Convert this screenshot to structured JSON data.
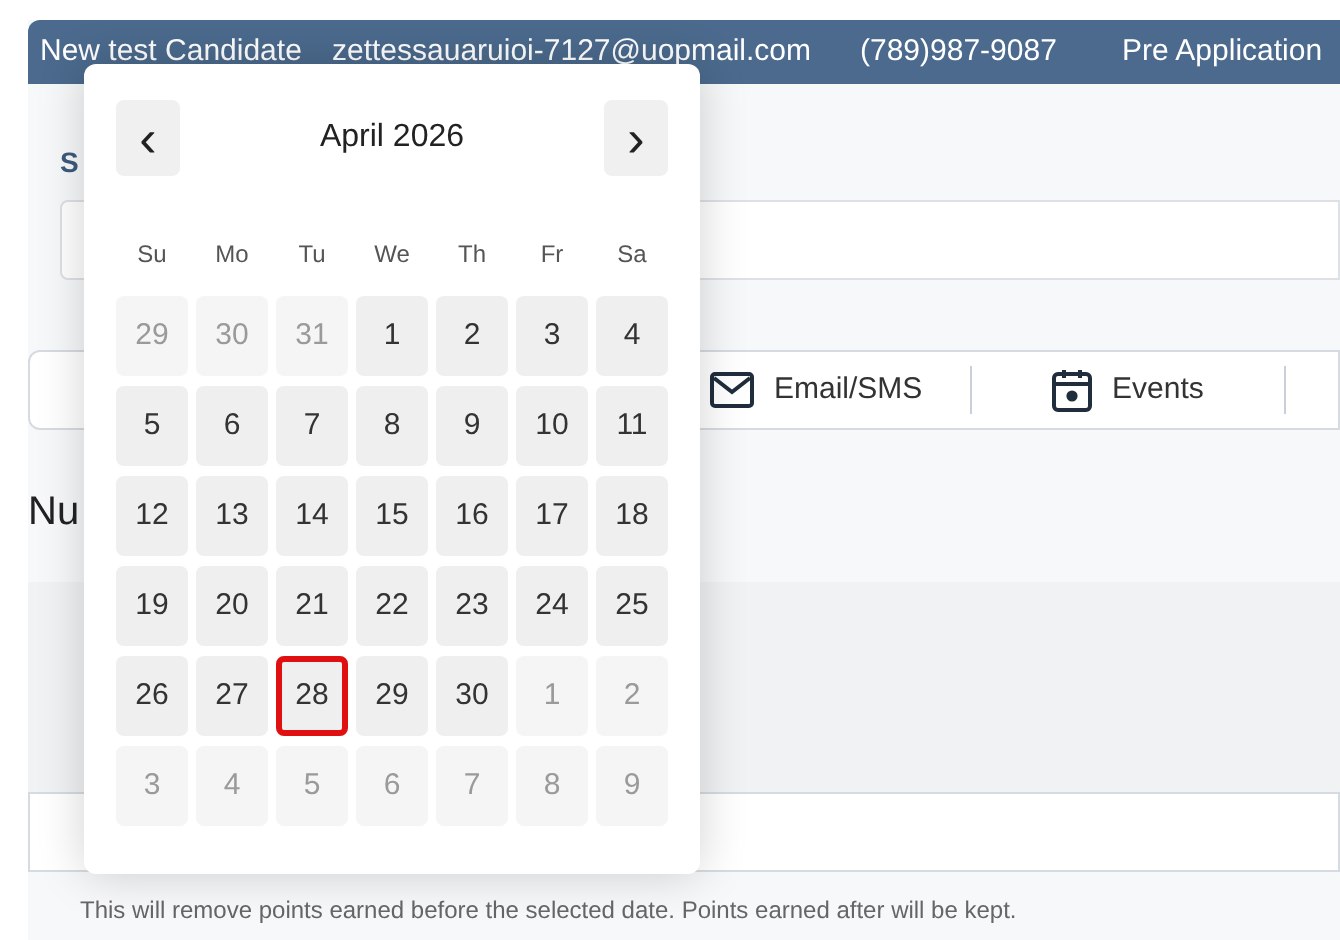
{
  "header": {
    "name": "New test Candidate",
    "email": "zettessauaruioi-7127@uopmail.com",
    "phone": "(789)987-9087",
    "stage": "Pre Application"
  },
  "section_label": "S",
  "tabs": [
    {
      "label": "Email/SMS",
      "kind": "mail"
    },
    {
      "label": "Events",
      "kind": "calendar"
    }
  ],
  "heading": "Nu",
  "helper_text": "This will remove points earned before the selected date. Points earned after will be kept.",
  "calendar": {
    "title": "April 2026",
    "prev": "‹",
    "next": "›",
    "weekdays": [
      "Su",
      "Mo",
      "Tu",
      "We",
      "Th",
      "Fr",
      "Sa"
    ],
    "weeks": [
      [
        {
          "label": "29",
          "outside": true,
          "selected": false
        },
        {
          "label": "30",
          "outside": true,
          "selected": false
        },
        {
          "label": "31",
          "outside": true,
          "selected": false
        },
        {
          "label": "1",
          "outside": false,
          "selected": false
        },
        {
          "label": "2",
          "outside": false,
          "selected": false
        },
        {
          "label": "3",
          "outside": false,
          "selected": false
        },
        {
          "label": "4",
          "outside": false,
          "selected": false
        }
      ],
      [
        {
          "label": "5",
          "outside": false,
          "selected": false
        },
        {
          "label": "6",
          "outside": false,
          "selected": false
        },
        {
          "label": "7",
          "outside": false,
          "selected": false
        },
        {
          "label": "8",
          "outside": false,
          "selected": false
        },
        {
          "label": "9",
          "outside": false,
          "selected": false
        },
        {
          "label": "10",
          "outside": false,
          "selected": false
        },
        {
          "label": "11",
          "outside": false,
          "selected": false
        }
      ],
      [
        {
          "label": "12",
          "outside": false,
          "selected": false
        },
        {
          "label": "13",
          "outside": false,
          "selected": false
        },
        {
          "label": "14",
          "outside": false,
          "selected": false
        },
        {
          "label": "15",
          "outside": false,
          "selected": false
        },
        {
          "label": "16",
          "outside": false,
          "selected": false
        },
        {
          "label": "17",
          "outside": false,
          "selected": false
        },
        {
          "label": "18",
          "outside": false,
          "selected": false
        }
      ],
      [
        {
          "label": "19",
          "outside": false,
          "selected": false
        },
        {
          "label": "20",
          "outside": false,
          "selected": false
        },
        {
          "label": "21",
          "outside": false,
          "selected": false
        },
        {
          "label": "22",
          "outside": false,
          "selected": false
        },
        {
          "label": "23",
          "outside": false,
          "selected": false
        },
        {
          "label": "24",
          "outside": false,
          "selected": false
        },
        {
          "label": "25",
          "outside": false,
          "selected": false
        }
      ],
      [
        {
          "label": "26",
          "outside": false,
          "selected": false
        },
        {
          "label": "27",
          "outside": false,
          "selected": false
        },
        {
          "label": "28",
          "outside": false,
          "selected": true
        },
        {
          "label": "29",
          "outside": false,
          "selected": false
        },
        {
          "label": "30",
          "outside": false,
          "selected": false
        },
        {
          "label": "1",
          "outside": true,
          "selected": false
        },
        {
          "label": "2",
          "outside": true,
          "selected": false
        }
      ],
      [
        {
          "label": "3",
          "outside": true,
          "selected": false
        },
        {
          "label": "4",
          "outside": true,
          "selected": false
        },
        {
          "label": "5",
          "outside": true,
          "selected": false
        },
        {
          "label": "6",
          "outside": true,
          "selected": false
        },
        {
          "label": "7",
          "outside": true,
          "selected": false
        },
        {
          "label": "8",
          "outside": true,
          "selected": false
        },
        {
          "label": "9",
          "outside": true,
          "selected": false
        }
      ]
    ]
  }
}
